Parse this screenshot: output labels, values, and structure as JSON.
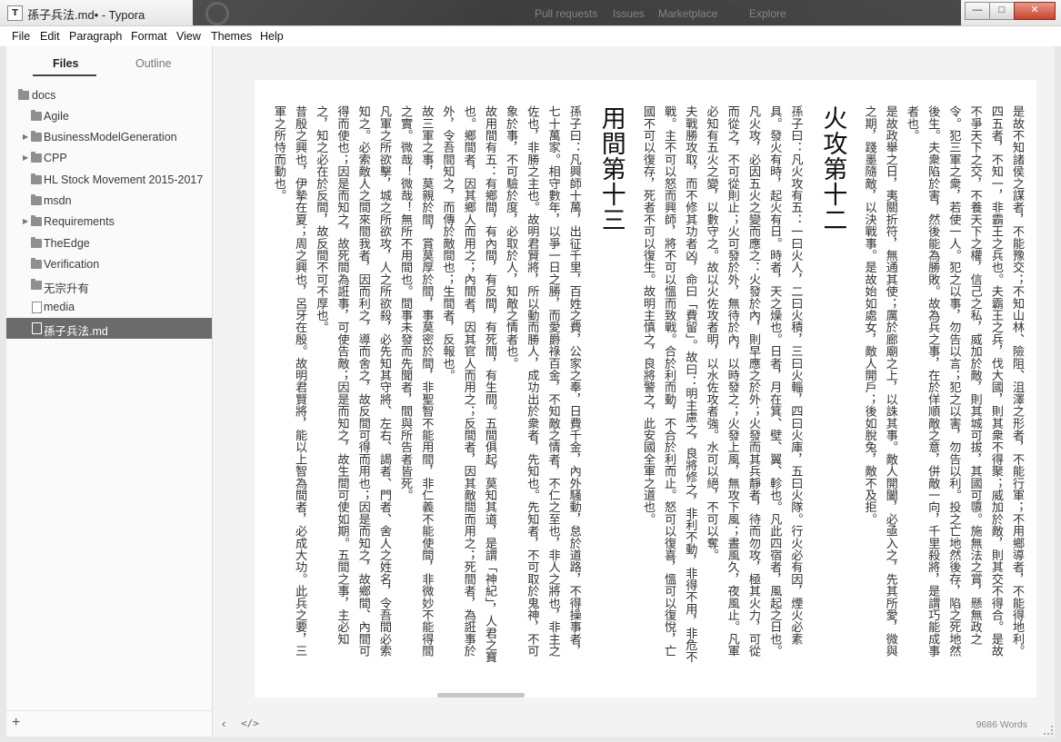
{
  "window": {
    "title": "孫子兵法.md• - Typora",
    "app_icon": "T",
    "background_strip": [
      "Pull requests",
      "Issues",
      "Marketplace",
      "Explore"
    ],
    "controls": {
      "minimize": "—",
      "maximize": "□",
      "close": "✕"
    }
  },
  "menu": [
    "File",
    "Edit",
    "Paragraph",
    "Format",
    "View",
    "Themes",
    "Help"
  ],
  "sidebar": {
    "tabs": [
      "Files",
      "Outline"
    ],
    "active_tab": "Files",
    "tree": [
      {
        "label": "docs",
        "kind": "folder",
        "depth": 0,
        "expandable": false
      },
      {
        "label": "Agile",
        "kind": "folder",
        "depth": 1,
        "expandable": false
      },
      {
        "label": "BusinessModelGeneration",
        "kind": "folder",
        "depth": 1,
        "expandable": true
      },
      {
        "label": "CPP",
        "kind": "folder",
        "depth": 1,
        "expandable": true
      },
      {
        "label": "HL Stock Movement 2015-2017",
        "kind": "folder",
        "depth": 1,
        "expandable": false
      },
      {
        "label": "msdn",
        "kind": "folder",
        "depth": 1,
        "expandable": false
      },
      {
        "label": "Requirements",
        "kind": "folder",
        "depth": 1,
        "expandable": true
      },
      {
        "label": "TheEdge",
        "kind": "folder",
        "depth": 1,
        "expandable": false
      },
      {
        "label": "Verification",
        "kind": "folder",
        "depth": 1,
        "expandable": false
      },
      {
        "label": "无宗升有",
        "kind": "folder",
        "depth": 1,
        "expandable": false
      },
      {
        "label": "media",
        "kind": "file",
        "depth": 1,
        "expandable": false
      },
      {
        "label": "孫子兵法.md",
        "kind": "file",
        "depth": 1,
        "expandable": false,
        "selected": true
      }
    ],
    "add_button": "+"
  },
  "document": {
    "blocks": [
      {
        "type": "p",
        "text": "是故不知諸侯之謀者，不能豫交；不知山林、險阻、沮澤之形者，不能行軍；不用鄉導者，不能得地利。四五者，不知一，非霸王之兵也。夫霸王之兵，伐大國，則其衆不得聚；威加於敵，則其交不得合。是故不爭天下之交，不養天下之權，信己之私，威加於敵，則其城可拔，其國可隳。施無法之賞，懸無政之令。犯三軍之衆，若使一人。犯之以事，勿告以言；犯之以害，勿告以利。投之亡地然後存，陷之死地然後生。夫衆陷於害，然後能為勝敗。故為兵之事，在於佯順敵之意，併敵一向，千里殺將，是謂巧能成事者也。"
      },
      {
        "type": "p",
        "text": "是故政舉之日，夷關折符，無通其使；厲於廊廟之上，以誅其事。敵人開闔，必亟入之，先其所愛，微與之期，踐墨隨敵，以決戰事。是故始如處女，敵人開戶；後如脫兔，敵不及拒。"
      },
      {
        "type": "h1",
        "text": "火攻第十二"
      },
      {
        "type": "p",
        "text": "孫子曰：凡火攻有五：一曰火人，二曰火積，三曰火輜，四曰火庫，五曰火隊。行火必有因，煙火必素具。發火有時，起火有日。時者，天之燥也。日者，月在箕、壁、翼、軫也。凡此四宿者，風起之日也。"
      },
      {
        "type": "p",
        "text": "凡火攻，必因五火之變而應之：火發於內，則早應之於外；火發而其兵靜者，待而勿攻，極其火力，可從而從之，不可從則止；火可發於外，無待於內，以時發之；火發上風，無攻下風；晝風久，夜風止。凡軍必知有五火之變，以數守之。故以火佐攻者明，以水佐攻者強。水可以絕，不可以奪。"
      },
      {
        "type": "p",
        "text": "夫戰勝攻取，而不修其功者凶，命曰「費留」。故曰：明主慮之，良將修之，非利不動，非得不用，非危不戰。主不可以怒而興師，將不可以慍而致戰。合於利而動，不合於利而止。怒可以復喜，慍可以復悅，亡國不可以復存，死者不可以復生。故明主慎之，良將警之，此安國全軍之道也。"
      },
      {
        "type": "h1",
        "text": "用間第十三"
      },
      {
        "type": "p",
        "text": "孫子曰：凡興師十萬，出征千里，百姓之費，公家之奉，日費千金，內外騷動，怠於道路，不得操事者，七十萬家。相守數年，以爭一日之勝，而愛爵祿百金，不知敵之情者，不仁之至也，非人之將也，非主之佐也，非勝之主也。故明君賢將，所以動而勝人，成功出於衆者，先知也。先知者，不可取於鬼神，不可象於事，不可驗於度，必取於人，知敵之情者也。"
      },
      {
        "type": "p",
        "text": "故用間有五：有鄉間，有內間，有反間，有死間，有生間。五間俱起，莫知其道，是謂「神紀」，人君之寶也。鄉間者，因其鄉人而用之；內間者，因其官人而用之；反間者，因其敵間而用之；死間者，為誑事於外，令吾間知之，而傳於敵間也；生間者，反報也。"
      },
      {
        "type": "p",
        "text": "故三軍之事，莫親於間，賞莫厚於間，事莫密於間，非聖智不能用間，非仁義不能使間，非微妙不能得間之實。微哉！微哉！無所不用間也。間事未發而先聞者，間與所告者皆死。"
      },
      {
        "type": "p",
        "text": "凡軍之所欲擊，城之所欲攻，人之所欲殺，必先知其守將、左右、謁者、門者、舍人之姓名，令吾間必索知之。必索敵人之間來間我者，因而利之，導而舍之，故反間可得而用也；因是而知之，故鄉間、內間可得而使也；因是而知之，故死間為誑事，可使告敵；因是而知之，故生間可使如期。五間之事，主必知之，知之必在於反間，故反間不可不厚也。"
      },
      {
        "type": "p",
        "text": "昔殷之興也，伊摯在夏；周之興也，呂牙在殷。故明君賢將，能以上智為間者，必成大功。此兵之要，三軍之所恃而動也。"
      }
    ]
  },
  "footer": {
    "back": "‹",
    "source_mode": "</>",
    "word_count": "9686 Words"
  }
}
